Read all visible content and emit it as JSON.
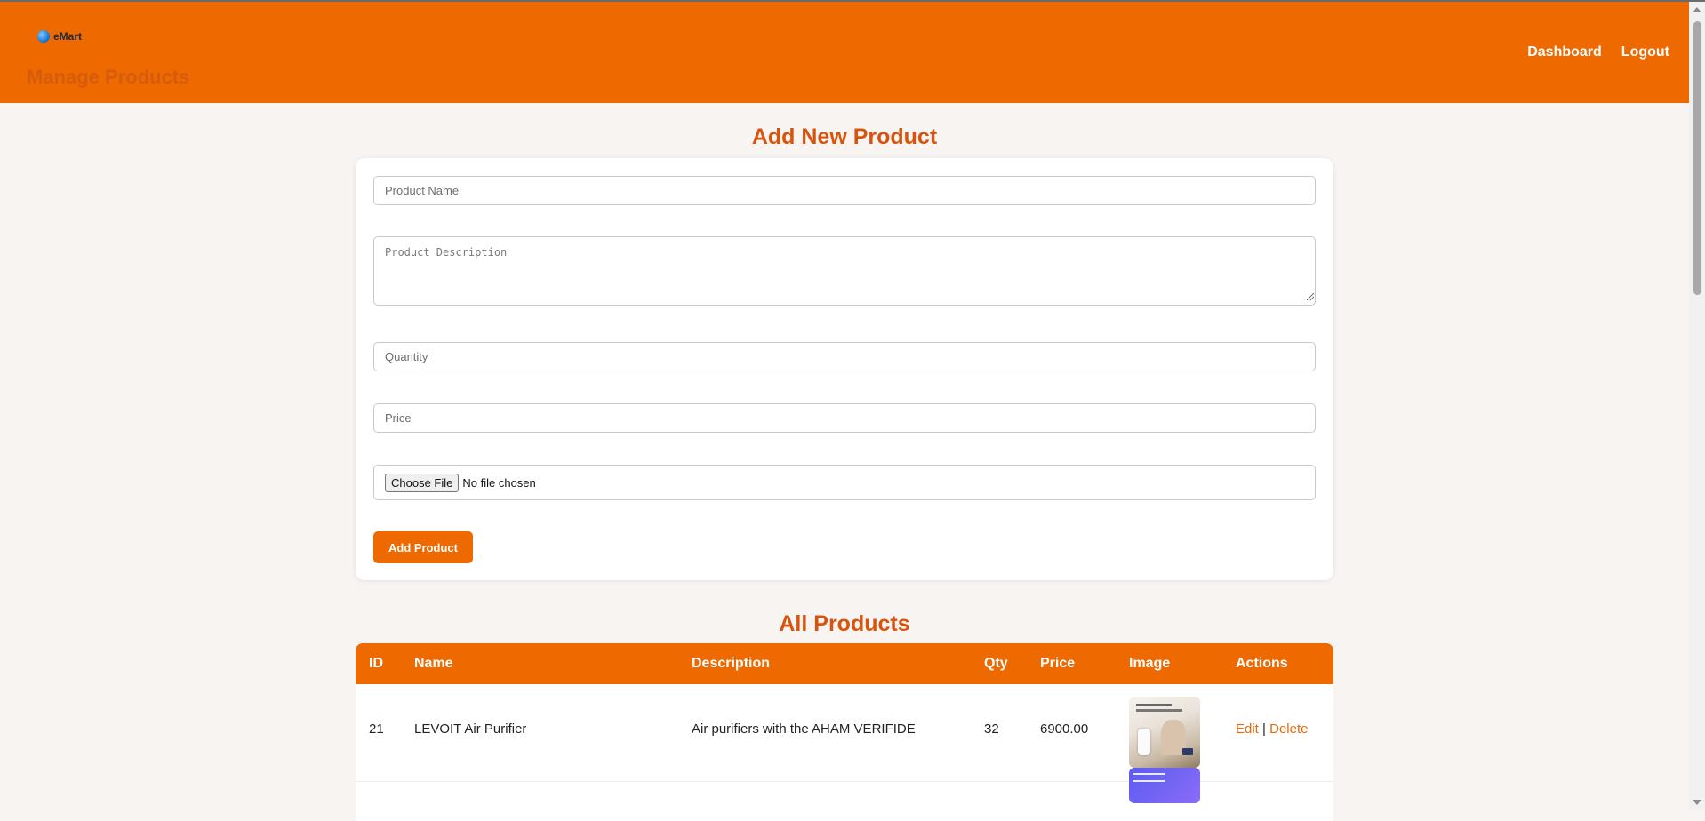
{
  "header": {
    "logo_text": "eMart",
    "page_title": "Manage Products",
    "nav": {
      "dashboard": "Dashboard",
      "logout": "Logout"
    }
  },
  "form": {
    "title": "Add New Product",
    "product_name_placeholder": "Product Name",
    "description_placeholder": "Product Description",
    "quantity_placeholder": "Quantity",
    "price_placeholder": "Price",
    "file_button": "Choose File",
    "file_status": "No file chosen",
    "submit_label": "Add Product"
  },
  "products": {
    "title": "All Products",
    "columns": [
      "ID",
      "Name",
      "Description",
      "Qty",
      "Price",
      "Image",
      "Actions"
    ],
    "rows": [
      {
        "id": "21",
        "name": "LEVOIT Air Purifier",
        "description": "Air purifiers with the AHAM VERIFIDE",
        "qty": "32",
        "price": "6900.00",
        "edit": "Edit",
        "separator": "|",
        "delete": "Delete"
      }
    ]
  },
  "colors": {
    "brand": "#ee6a00",
    "heading": "#d8540c",
    "link": "#e36a10",
    "background": "#f7f4f2"
  }
}
